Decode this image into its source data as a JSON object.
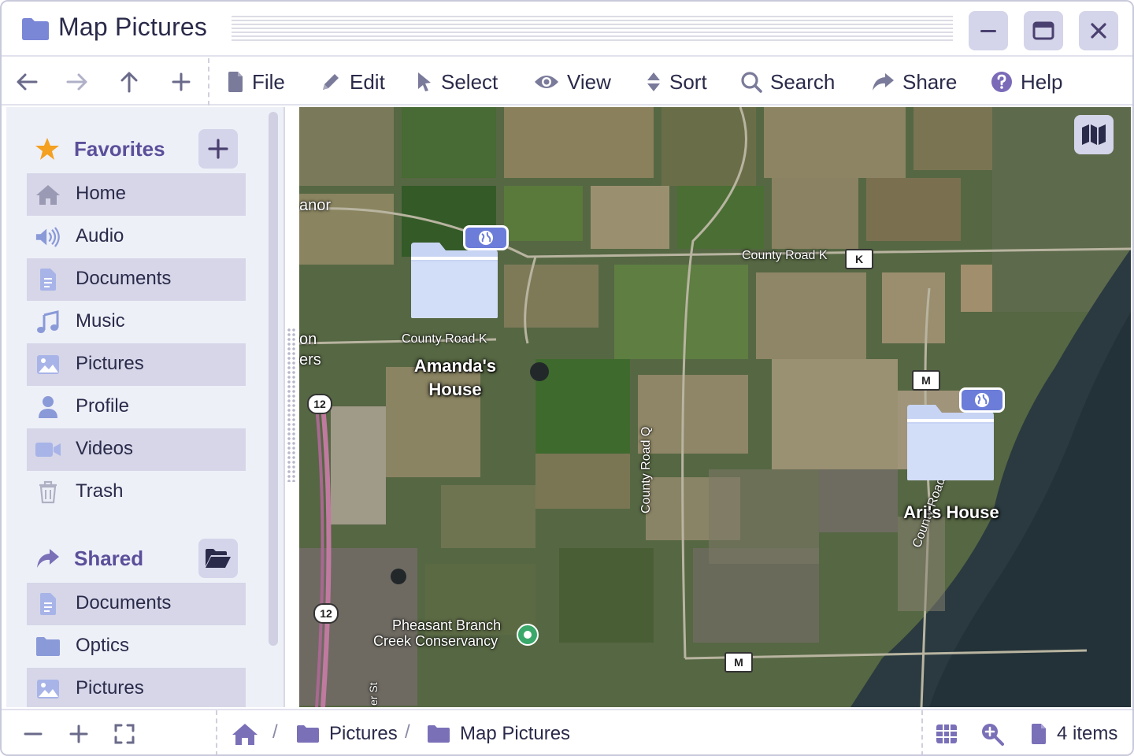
{
  "window": {
    "title": "Map Pictures",
    "controls": {
      "minimize_icon": "minimize-icon",
      "maximize_icon": "maximize-icon",
      "close_icon": "close-icon"
    }
  },
  "toolbar": {
    "nav": [
      {
        "name": "back",
        "icon": "arrow-left-icon"
      },
      {
        "name": "forward",
        "icon": "arrow-right-icon"
      },
      {
        "name": "up",
        "icon": "arrow-up-icon"
      },
      {
        "name": "new",
        "icon": "plus-icon"
      }
    ],
    "menu": [
      {
        "label": "File",
        "icon": "file-icon"
      },
      {
        "label": "Edit",
        "icon": "pencil-icon"
      },
      {
        "label": "Select",
        "icon": "cursor-icon"
      },
      {
        "label": "View",
        "icon": "eye-icon"
      },
      {
        "label": "Sort",
        "icon": "sort-icon"
      },
      {
        "label": "Search",
        "icon": "search-icon"
      },
      {
        "label": "Share",
        "icon": "share-icon"
      },
      {
        "label": "Help",
        "icon": "help-icon"
      }
    ]
  },
  "sidebar": {
    "favorites": {
      "title": "Favorites",
      "icon": "star-icon",
      "action_icon": "plus-icon",
      "items": [
        {
          "label": "Home",
          "icon": "home-icon"
        },
        {
          "label": "Audio",
          "icon": "speaker-icon"
        },
        {
          "label": "Documents",
          "icon": "document-icon"
        },
        {
          "label": "Music",
          "icon": "music-icon"
        },
        {
          "label": "Pictures",
          "icon": "image-icon"
        },
        {
          "label": "Profile",
          "icon": "user-icon"
        },
        {
          "label": "Videos",
          "icon": "video-icon"
        },
        {
          "label": "Trash",
          "icon": "trash-icon"
        }
      ]
    },
    "shared": {
      "title": "Shared",
      "icon": "share-icon",
      "action_icon": "folder-open-icon",
      "items": [
        {
          "label": "Documents",
          "icon": "document-icon"
        },
        {
          "label": "Optics",
          "icon": "folder-icon"
        },
        {
          "label": "Pictures",
          "icon": "image-icon"
        }
      ]
    }
  },
  "map": {
    "toggle_icon": "map-icon",
    "pins": [
      {
        "label_line1": "Amanda's",
        "label_line2": "House",
        "icon": "folder-icon",
        "badge_icon": "globe-icon"
      },
      {
        "label_line1": "Ari's House",
        "icon": "folder-icon",
        "badge_icon": "globe-icon"
      }
    ],
    "labels": {
      "road_k_top": "County Road K",
      "road_k_left": "County Road K",
      "road_q": "County Road Q",
      "road_m": "County Road M",
      "conservancy_line1": "Pheasant Branch",
      "conservancy_line2": "Creek Conservancy",
      "anor": "anor",
      "on": "on",
      "ers": "ers",
      "street": "er St"
    },
    "badges": {
      "k": "K",
      "m_top": "M",
      "m_bottom": "M",
      "hwy_top": "12",
      "hwy_bottom": "12"
    }
  },
  "statusbar": {
    "zoom_out_icon": "minus-icon",
    "zoom_in_icon": "plus-icon",
    "fullscreen_icon": "fullscreen-icon",
    "breadcrumb": {
      "home_icon": "home-icon",
      "separator": "/",
      "items": [
        {
          "label": "Pictures",
          "icon": "folder-icon"
        },
        {
          "label": "Map Pictures",
          "icon": "folder-icon"
        }
      ]
    },
    "grid_icon": "grid-icon",
    "zoom_icon": "zoom-icon",
    "count_icon": "file-icon",
    "item_count": "4 items"
  },
  "colors": {
    "accent": "#5a4f9a",
    "button_bg": "#d4d4ea",
    "folder": "#7a86d6",
    "sidebar_bg": "#eef0f8",
    "selected_bg": "#d6d6e8",
    "star": "#f4a020"
  }
}
